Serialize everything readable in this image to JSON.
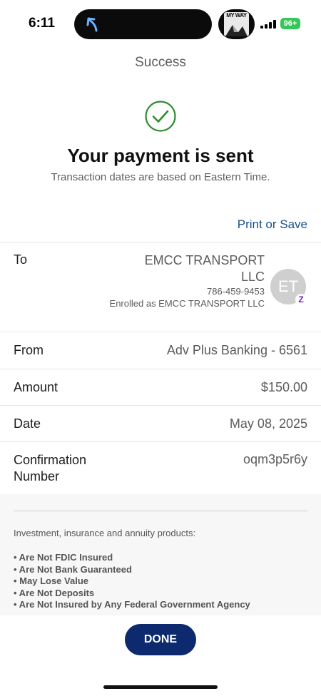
{
  "status_bar": {
    "time": "6:11",
    "app_badge_text": "MY WAY",
    "battery": "96"
  },
  "nav": {
    "title": "Success"
  },
  "confirmation": {
    "headline": "Your payment is sent",
    "subline": "Transaction dates are based on Eastern Time.",
    "print_link": "Print or Save"
  },
  "details": {
    "to": {
      "label": "To",
      "payee_name": "EMCC TRANSPORT LLC",
      "phone": "786-459-9453",
      "enrolled": "Enrolled as EMCC TRANSPORT LLC",
      "avatar_initials": "ET",
      "badge": "Z"
    },
    "from": {
      "label": "From",
      "value": "Adv Plus Banking - 6561"
    },
    "amount": {
      "label": "Amount",
      "value": "$150.00"
    },
    "date": {
      "label": "Date",
      "value": "May 08, 2025"
    },
    "confirmation_number": {
      "label": "Confirmation Number",
      "value": "oqm3p5r6y"
    }
  },
  "disclosure": {
    "intro": "Investment, insurance and annuity products:",
    "items": [
      "• Are Not FDIC Insured",
      "• Are Not Bank Guaranteed",
      "• May Lose Value",
      "• Are Not Deposits",
      "• Are Not Insured by Any Federal Government Agency"
    ]
  },
  "actions": {
    "done_label": "DONE"
  },
  "colors": {
    "success_green": "#2e8b2e",
    "link_blue": "#1a4f8b",
    "button_navy": "#0d2a6e",
    "zelle_purple": "#6d1ed4",
    "battery_green": "#34c759"
  },
  "icons": [
    "back-arrow-icon",
    "success-check-icon",
    "signal-icon",
    "zelle-icon"
  ]
}
